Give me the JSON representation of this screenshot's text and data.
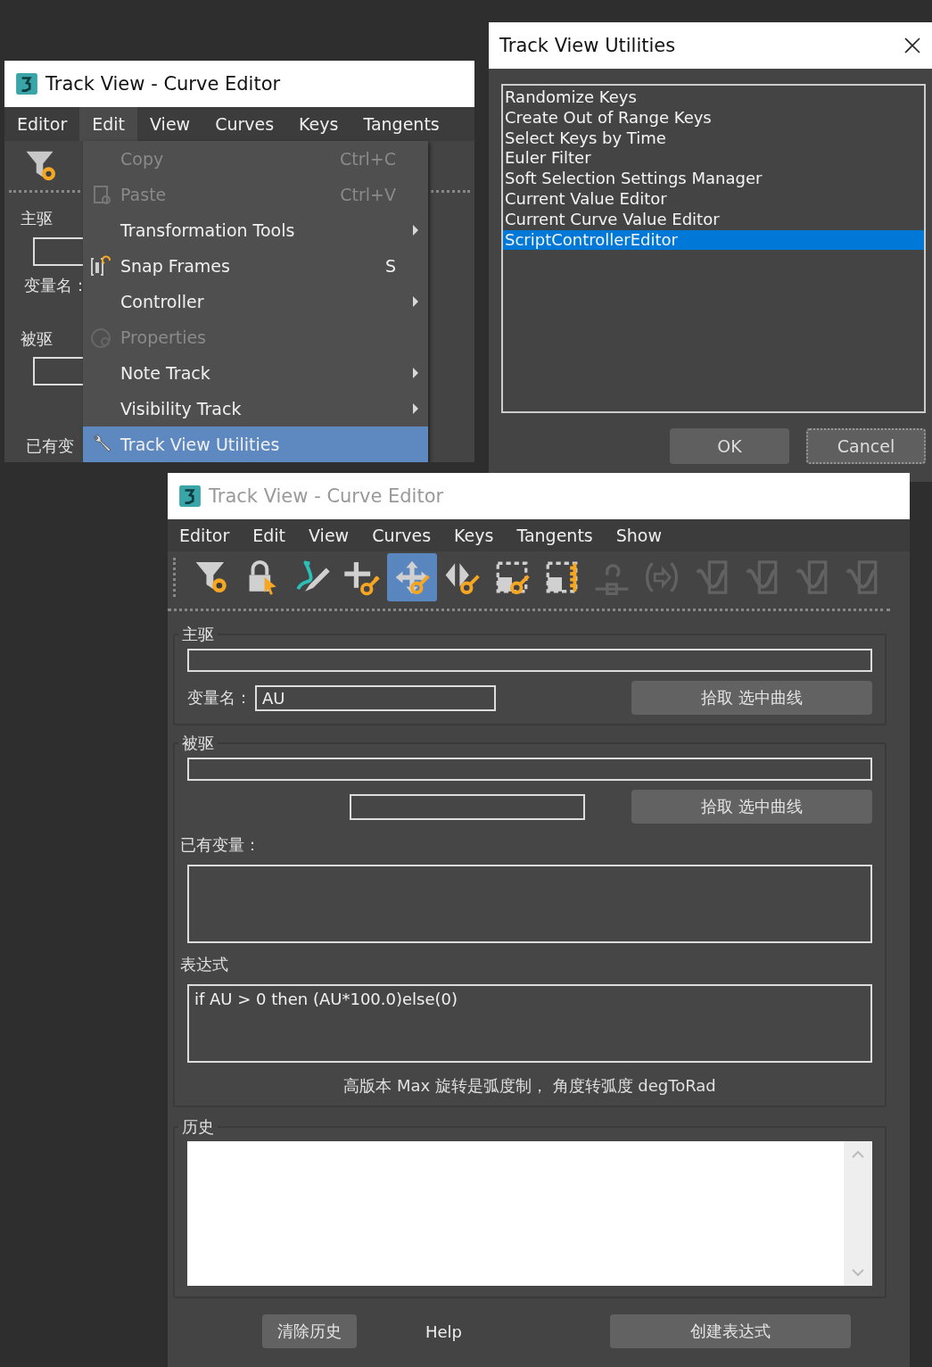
{
  "back_editor": {
    "title": "Track View - Curve Editor",
    "menus": [
      {
        "label": "Editor",
        "selected": false
      },
      {
        "label": "Edit",
        "selected": true
      },
      {
        "label": "View",
        "selected": false
      },
      {
        "label": "Curves",
        "selected": false
      },
      {
        "label": "Keys",
        "selected": false
      },
      {
        "label": "Tangents",
        "selected": false
      }
    ],
    "behind_labels": [
      "主驱",
      "变量名：",
      "被驱",
      "已有变"
    ],
    "edit_menu": [
      {
        "label": "Copy",
        "shortcut": "Ctrl+C",
        "disabled": true,
        "submenu": false,
        "selected": false
      },
      {
        "label": "Paste",
        "shortcut": "Ctrl+V",
        "disabled": true,
        "submenu": false,
        "selected": false
      },
      {
        "label": "Transformation Tools",
        "disabled": false,
        "submenu": true,
        "selected": false
      },
      {
        "label": "Snap Frames",
        "shortcut": "S",
        "disabled": false,
        "submenu": false,
        "selected": false
      },
      {
        "label": "Controller",
        "disabled": false,
        "submenu": true,
        "selected": false
      },
      {
        "label": "Properties",
        "disabled": true,
        "submenu": false,
        "selected": false
      },
      {
        "label": "Note Track",
        "disabled": false,
        "submenu": true,
        "selected": false
      },
      {
        "label": "Visibility Track",
        "disabled": false,
        "submenu": true,
        "selected": false
      },
      {
        "label": "Track View Utilities",
        "disabled": false,
        "submenu": false,
        "selected": true
      }
    ]
  },
  "utilities_dialog": {
    "title": "Track View Utilities",
    "items": [
      {
        "label": "Randomize Keys",
        "selected": false
      },
      {
        "label": "Create Out of Range Keys",
        "selected": false
      },
      {
        "label": "Select Keys by Time",
        "selected": false
      },
      {
        "label": "Euler Filter",
        "selected": false
      },
      {
        "label": "Soft Selection Settings Manager",
        "selected": false
      },
      {
        "label": "Current Value Editor",
        "selected": false
      },
      {
        "label": "Current Curve Value Editor",
        "selected": false
      },
      {
        "label": "ScriptControllerEditor",
        "selected": true
      }
    ],
    "ok": "OK",
    "cancel": "Cancel"
  },
  "front_editor": {
    "title": "Track View - Curve Editor",
    "menus": [
      "Editor",
      "Edit",
      "View",
      "Curves",
      "Keys",
      "Tangents",
      "Show"
    ],
    "toolbar": [
      {
        "selected": false,
        "disabled": false
      },
      {
        "selected": false,
        "disabled": false
      },
      {
        "selected": false,
        "disabled": false
      },
      {
        "selected": false,
        "disabled": false
      },
      {
        "selected": true,
        "disabled": false
      },
      {
        "selected": false,
        "disabled": false
      },
      {
        "selected": false,
        "disabled": false
      },
      {
        "selected": false,
        "disabled": false
      },
      {
        "selected": false,
        "disabled": true
      },
      {
        "selected": false,
        "disabled": true
      },
      {
        "selected": false,
        "disabled": true
      },
      {
        "selected": false,
        "disabled": true
      },
      {
        "selected": false,
        "disabled": true
      },
      {
        "selected": false,
        "disabled": true
      }
    ],
    "driver": {
      "legend": "主驱",
      "var_label": "变量名：",
      "var_value": "AU",
      "pick": "拾取 选中曲线"
    },
    "driven": {
      "legend": "被驱",
      "pick": "拾取 选中曲线",
      "existing_label": "已有变量：",
      "expression_label": "表达式",
      "expression": "if AU > 0 then (AU*100.0)else(0)",
      "note": "高版本 Max 旋转是弧度制， 角度转弧度 degToRad"
    },
    "history": {
      "legend": "历史"
    },
    "clear": "清除历史",
    "help": "Help",
    "create": "创建表达式"
  }
}
